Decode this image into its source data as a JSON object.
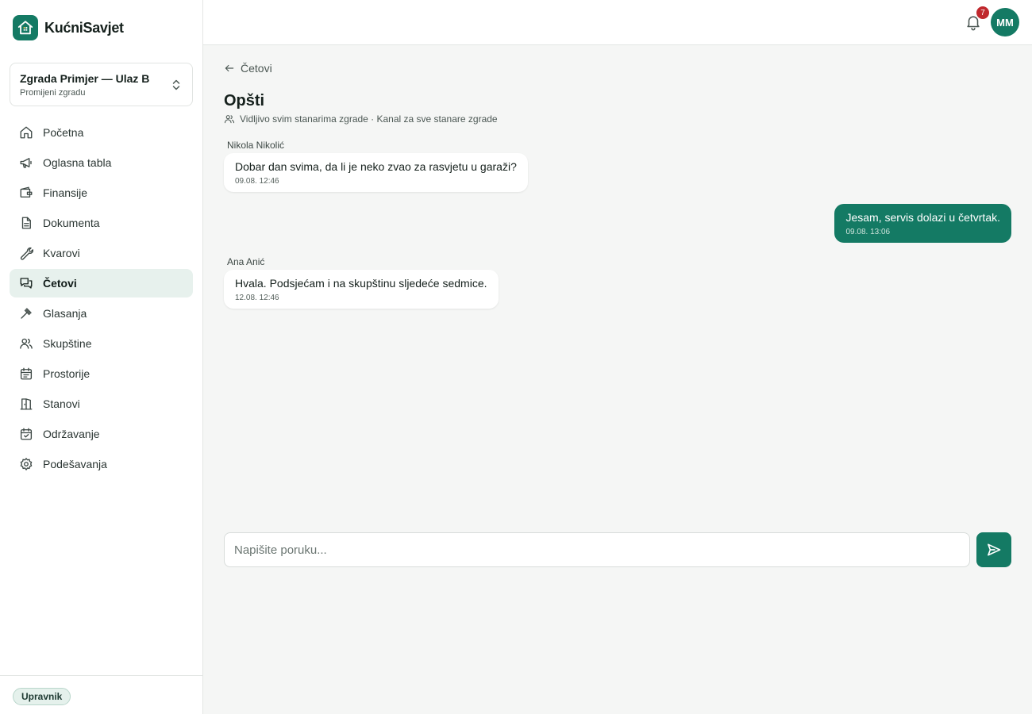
{
  "app": {
    "name": "KućniSavjet",
    "accent": "#147a64"
  },
  "building": {
    "name": "Zgrada Primjer — Ulaz B",
    "subtitle": "Promijeni zgradu"
  },
  "sidebar": {
    "items": [
      {
        "label": "Početna",
        "icon": "home-icon"
      },
      {
        "label": "Oglasna tabla",
        "icon": "megaphone-icon"
      },
      {
        "label": "Finansije",
        "icon": "wallet-icon"
      },
      {
        "label": "Dokumenta",
        "icon": "document-icon"
      },
      {
        "label": "Kvarovi",
        "icon": "wrench-icon"
      },
      {
        "label": "Četovi",
        "icon": "chat-icon",
        "active": true
      },
      {
        "label": "Glasanja",
        "icon": "gavel-icon"
      },
      {
        "label": "Skupštine",
        "icon": "users-icon"
      },
      {
        "label": "Prostorije",
        "icon": "calendar-icon"
      },
      {
        "label": "Stanovi",
        "icon": "door-icon"
      },
      {
        "label": "Održavanje",
        "icon": "calendar-check-icon"
      },
      {
        "label": "Podešavanja",
        "icon": "gear-icon"
      }
    ],
    "role_badge": "Upravnik"
  },
  "topbar": {
    "notification_count": "7",
    "avatar_initials": "MM"
  },
  "chat": {
    "back_label": "Četovi",
    "title": "Opšti",
    "subtitle": "Vidljivo svim stanarima zgrade · Kanal za sve stanare zgrade",
    "messages": [
      {
        "author": "Nikola Nikolić",
        "text": "Dobar dan svima, da li je neko zvao za rasvjetu u garaži?",
        "time": "09.08. 12:46",
        "outgoing": false
      },
      {
        "author": "",
        "text": "Jesam, servis dolazi u četvrtak.",
        "time": "09.08. 13:06",
        "outgoing": true
      },
      {
        "author": "Ana Anić",
        "text": "Hvala. Podsjećam i na skupštinu sljedeće sedmice.",
        "time": "12.08. 12:46",
        "outgoing": false
      }
    ],
    "composer_placeholder": "Napišite poruku..."
  }
}
